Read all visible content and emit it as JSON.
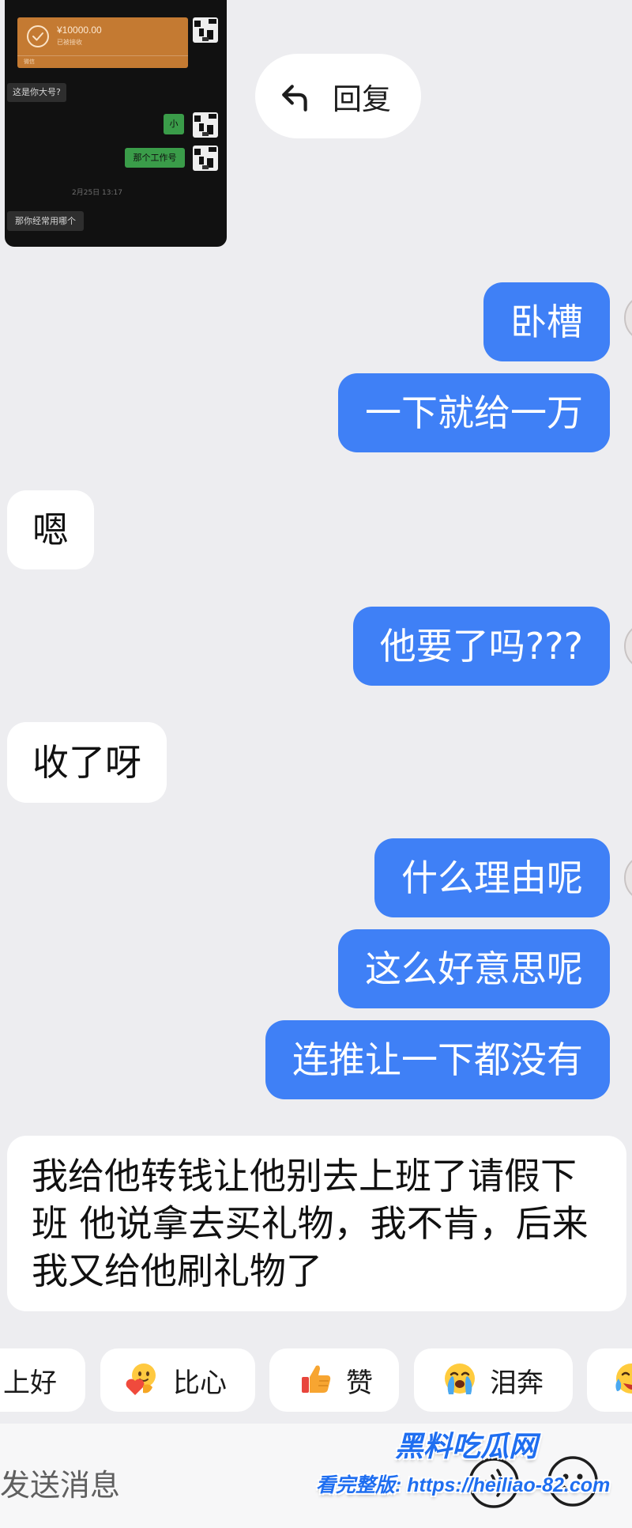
{
  "colors": {
    "page_background": "#ededf0",
    "outgoing_bubble": "#3f80f6",
    "incoming_bubble": "#ffffff",
    "quoted_green_bubble": "#3a9c49",
    "transfer_card": "#c47a32",
    "watermark": "#1f6ef0"
  },
  "quoted_screenshot": {
    "transfer": {
      "icon": "check-circle-icon",
      "amount": "¥10000.00",
      "status": "已被接收",
      "source": "微信"
    },
    "messages": [
      {
        "outgoing": false,
        "text": "这是你大号?"
      },
      {
        "outgoing": true,
        "text": "小"
      },
      {
        "outgoing": true,
        "text": "那个工作号"
      },
      {
        "outgoing": false,
        "text": "那你经常用哪个"
      }
    ],
    "timestamp": "2月25日 13:17"
  },
  "reply_button": {
    "icon": "reply-arrow-icon",
    "label": "回复"
  },
  "chat": {
    "messages": [
      {
        "outgoing": true,
        "text": "卧槽"
      },
      {
        "outgoing": true,
        "text": "一下就给一万"
      },
      {
        "outgoing": false,
        "text": "嗯"
      },
      {
        "outgoing": true,
        "text": "他要了吗???"
      },
      {
        "outgoing": false,
        "text": "收了呀"
      },
      {
        "outgoing": true,
        "text": "什么理由呢"
      },
      {
        "outgoing": true,
        "text": "这么好意思呢"
      },
      {
        "outgoing": true,
        "text": "连推让一下都没有"
      },
      {
        "outgoing": false,
        "lines": [
          "我给他转钱让他别去上班了请假下",
          "班 他说拿去买礼物，我不肯，后来",
          "我又给他刷礼物了"
        ]
      }
    ]
  },
  "quick_reactions": [
    {
      "label": "上好"
    },
    {
      "label": "比心",
      "icon": "heart-hands-emoji-icon"
    },
    {
      "label": "赞",
      "icon": "thumbs-up-emoji-icon"
    },
    {
      "label": "泪奔",
      "icon": "crying-face-emoji-icon"
    },
    {
      "icon": "tears-of-joy-emoji-icon"
    }
  ],
  "composer": {
    "placeholder": "发送消息",
    "voice_icon": "voice-icon",
    "emoji_icon": "smiley-icon"
  },
  "watermark": {
    "brand": "黑料吃瓜网",
    "link_text": "看完整版: https://heiliao-82.com"
  }
}
